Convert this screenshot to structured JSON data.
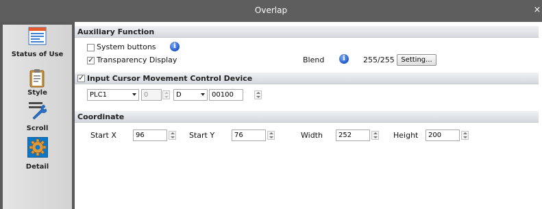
{
  "window": {
    "title": "Overlap",
    "close_glyph": "×"
  },
  "nav": {
    "items": [
      {
        "label": "Status of Use",
        "icon": "status-of-use-icon"
      },
      {
        "label": "Style",
        "icon": "style-clipboard-icon"
      },
      {
        "label": "Scroll",
        "icon": "scroll-wrench-icon"
      },
      {
        "label": "Detail",
        "icon": "detail-gear-icon",
        "selected": true
      }
    ]
  },
  "auxiliary": {
    "heading": "Auxiliary Function",
    "system_buttons": {
      "label": "System buttons",
      "checked": false
    },
    "transparency": {
      "label": "Transparency Display",
      "checked": true
    },
    "blend_label": "Blend",
    "blend_value": "255/255",
    "setting_button": "Setting..."
  },
  "input_cursor": {
    "heading": "Input Cursor Movement Control Device",
    "checked": true,
    "plc": "PLC1",
    "station": "0",
    "device": "D",
    "address": "00100"
  },
  "coordinate": {
    "heading": "Coordinate",
    "start_x_label": "Start X",
    "start_x": "96",
    "start_y_label": "Start Y",
    "start_y": "76",
    "width_label": "Width",
    "width": "252",
    "height_label": "Height",
    "height": "200"
  },
  "colors": {
    "titlebar": "#5e5e5e",
    "section_header": "#d5d9df",
    "nav_selected": "#0d77c7"
  }
}
